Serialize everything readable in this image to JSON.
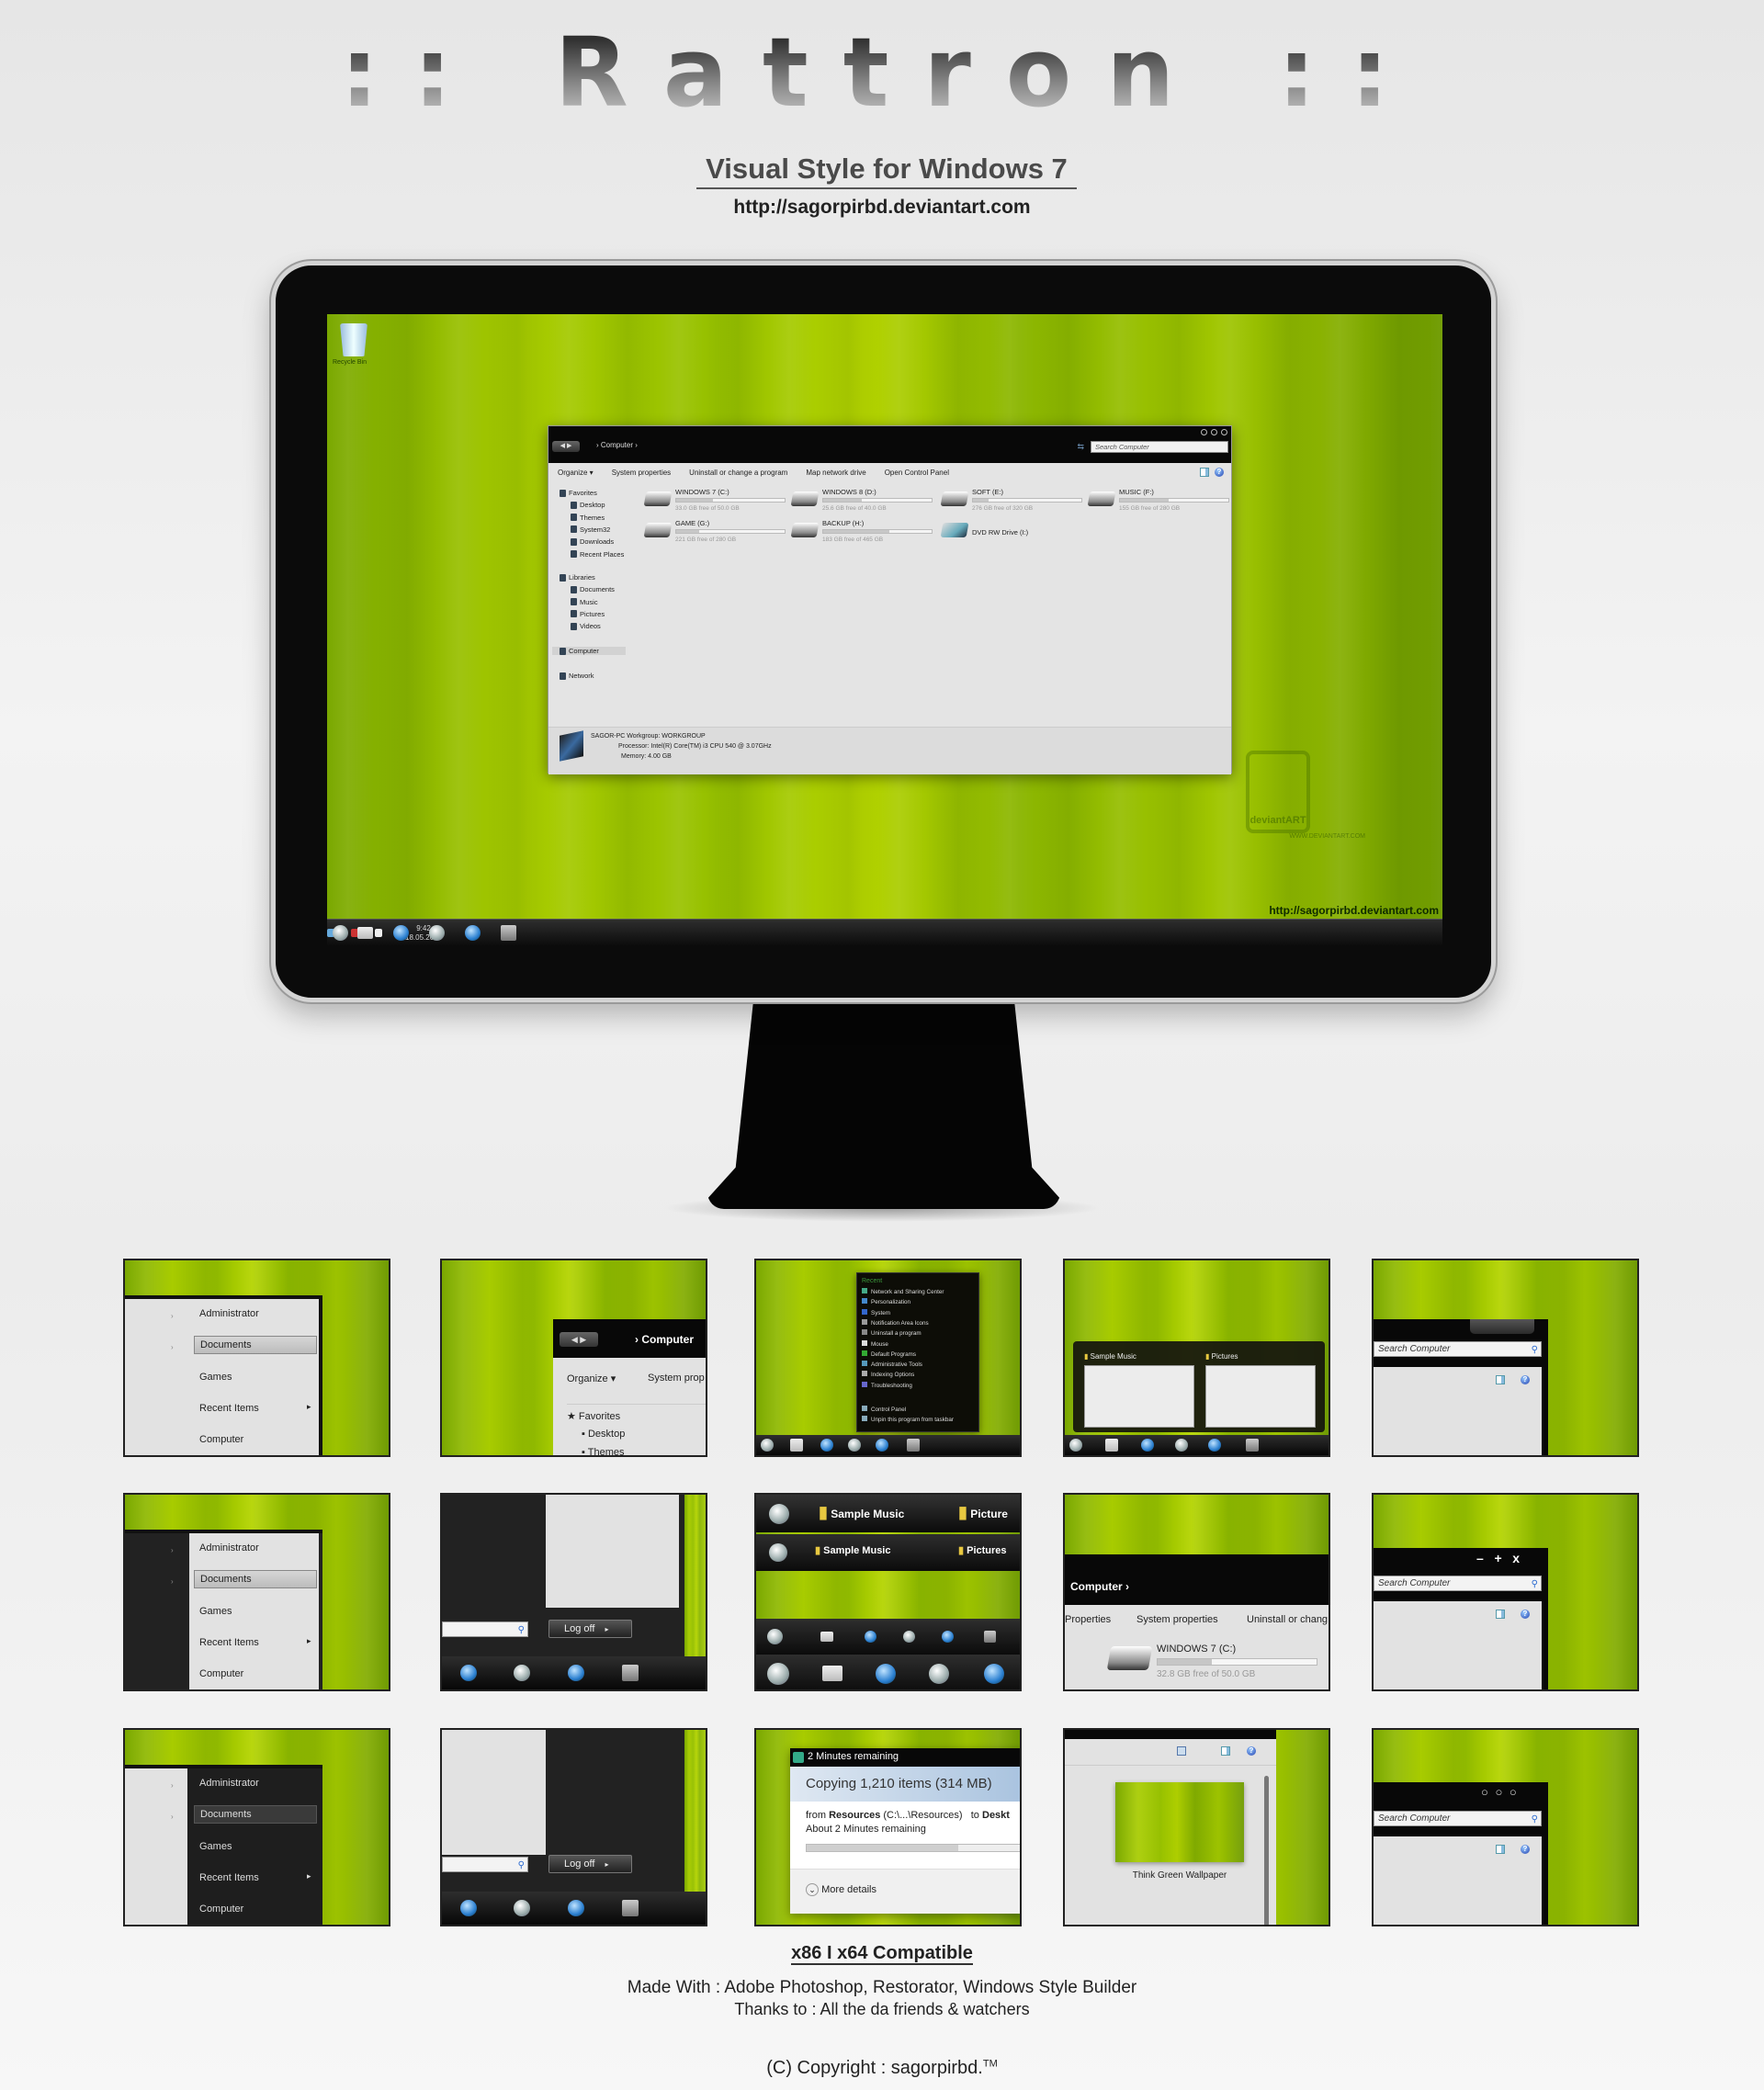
{
  "header": {
    "title": ":: Rattron ::",
    "subtitle": "Visual Style for Windows 7",
    "url": "http://sagorpirbd.deviantart.com"
  },
  "desktop": {
    "recycle_bin_label": "Recycle Bin",
    "watermark_logo": "deviantART",
    "watermark_text": "WWW.DEVIANTART.COM",
    "url": "http://sagorpirbd.deviantart.com",
    "clock_time": "9:42",
    "clock_date": "18.05.2013",
    "taskbar_icons": [
      "start-orb-icon",
      "folder-icon",
      "ie-icon",
      "media-player-icon",
      "chrome-icon",
      "app-icon"
    ],
    "colors": {
      "wallpaper_green": "#9fc400",
      "taskbar": "#111111",
      "window": "#e4e4e4"
    }
  },
  "explorer": {
    "nav_buttons": "◀ ▶",
    "breadcrumb": "›  Computer  ›",
    "search_placeholder": "Search Computer",
    "commands": [
      "Organize ▾",
      "System properties",
      "Uninstall or change a program",
      "Map network drive",
      "Open Control Panel"
    ],
    "nav": {
      "favorites": [
        "Favorites",
        "Desktop",
        "Themes",
        "System32",
        "Downloads",
        "Recent Places"
      ],
      "libraries": [
        "Libraries",
        "Documents",
        "Music",
        "Pictures",
        "Videos"
      ],
      "computer": "Computer",
      "network": "Network"
    },
    "drives": [
      {
        "name": "WINDOWS 7 (C:)",
        "free": "33.0 GB free of 50.0 GB",
        "used": 0.34
      },
      {
        "name": "WINDOWS 8 (D:)",
        "free": "25.6 GB free of 40.0 GB",
        "used": 0.36
      },
      {
        "name": "SOFT (E:)",
        "free": "276 GB free of 320 GB",
        "used": 0.14
      },
      {
        "name": "MUSIC (F:)",
        "free": "155 GB free of 280 GB",
        "used": 0.45
      },
      {
        "name": "GAME (G:)",
        "free": "221 GB free of 280 GB",
        "used": 0.21
      },
      {
        "name": "BACKUP (H:)",
        "free": "183 GB free of 465 GB",
        "used": 0.61
      },
      {
        "name": "DVD RW Drive (I:)"
      }
    ],
    "details": {
      "line1": "SAGOR-PC  Workgroup: WORKGROUP",
      "line2": "Processor: Intel(R) Core(TM) i3 CPU      540 @ 3.07GHz",
      "line3": "Memory: 4.00 GB"
    }
  },
  "tiles": {
    "start_menu_items": [
      "Administrator",
      "Documents",
      "Games",
      "Recent Items",
      "Computer"
    ],
    "submenu_arrow": "▸",
    "logoff_label": "Log off",
    "explorer_crumb": "Computer",
    "organize": "Organize ▾",
    "system_prop_short": "System prop",
    "nav_favorites": "Favorites",
    "nav_desktop": "Desktop",
    "nav_themes": "Themes",
    "jump_list": {
      "header": "Recent",
      "items": [
        "Network and Sharing Center",
        "Personalization",
        "System",
        "Notification Area Icons",
        "Uninstall a program",
        "Mouse",
        "Default Programs",
        "Administrative Tools",
        "Indexing Options",
        "Troubleshooting"
      ],
      "tasks": [
        "Control Panel",
        "Unpin this program from taskbar"
      ]
    },
    "previews": [
      "Sample Music",
      "Pictures"
    ],
    "search_placeholder": "Search Computer",
    "taskbar_sizes": {
      "big_a": "Sample Music",
      "big_b": "Picture",
      "small_a": "Sample Music",
      "small_b": "Pictures"
    },
    "explorer_cmds": [
      "Properties",
      "System properties",
      "Uninstall or chang"
    ],
    "drive": {
      "name": "WINDOWS 7 (C:)",
      "free": "32.8 GB free of 50.0 GB",
      "used": 0.34
    },
    "caption_buttons_a": "–   +   x",
    "caption_buttons_b": "○ ○ ○",
    "copy_dialog": {
      "title": "2 Minutes remaining",
      "heading": "Copying 1,210 items (314 MB)",
      "from_label": "from",
      "from_name": "Resources",
      "from_path": "(C:\\...\\Resources)",
      "to_label": "to",
      "to_name": "Deskt",
      "remaining": "About 2 Minutes remaining",
      "progress": 0.7,
      "more_details": "More details"
    },
    "wallpaper_label": "Think Green Wallpaper"
  },
  "footer": {
    "compat": "x86 I x64 Compatible",
    "made_with": "Made With : Adobe Photoshop, Restorator, Windows Style Builder",
    "thanks": "Thanks to : All the da friends & watchers",
    "copyright": "(C) Copyright : sagorpirbd.",
    "tm": "TM"
  }
}
